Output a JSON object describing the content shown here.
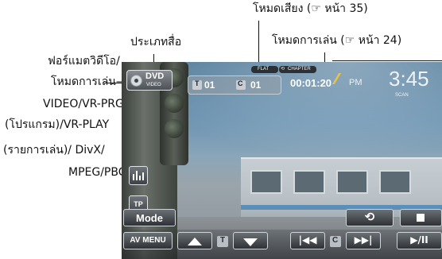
{
  "callouts": {
    "sound_mode": "โหมดเสียง (☞ หน้า 35)",
    "media_type": "ประเภทสื่อ",
    "play_mode": "โหมดการเล่น (☞ หน้า 24)",
    "video_format_lines": [
      "ฟอร์แมตวิดีโอ/",
      "โหมดการเล่น—",
      "VIDEO/VR-PRG",
      "(โปรแกรม)/VR-PLAY",
      "(รายการเล่น)/ DivX/",
      "MPEG/PBC"
    ]
  },
  "screen": {
    "disc_label": "DVD",
    "disc_sub": "VIDEO",
    "title_num": "01",
    "chapter_num": "01",
    "title_badge": "T",
    "chapter_badge": "C",
    "elapsed": "00:01:20",
    "sound_tag": "FLAT",
    "chapter_tag": "CHAPTER",
    "chapter_tag_icon": "repeat-icon",
    "ampm": "PM",
    "clock": "3:45",
    "scan_tag": "SCAN",
    "tp_label": "TP",
    "mode_label": "Mode",
    "av_menu_label": "AV MENU",
    "title_mini": "T",
    "chapter_mini": "C",
    "icons": {
      "equalizer": "equalizer-icon",
      "repeat": "repeat-icon",
      "stop": "stop-icon",
      "up": "up-arrow-icon",
      "down": "down-arrow-icon",
      "prev": "previous-icon",
      "next": "next-icon",
      "play_pause": "play-pause-icon"
    }
  },
  "colors": {
    "accent_yellow": "#e6c24a",
    "button_text": "#ffffff",
    "background": "#ffffff"
  }
}
